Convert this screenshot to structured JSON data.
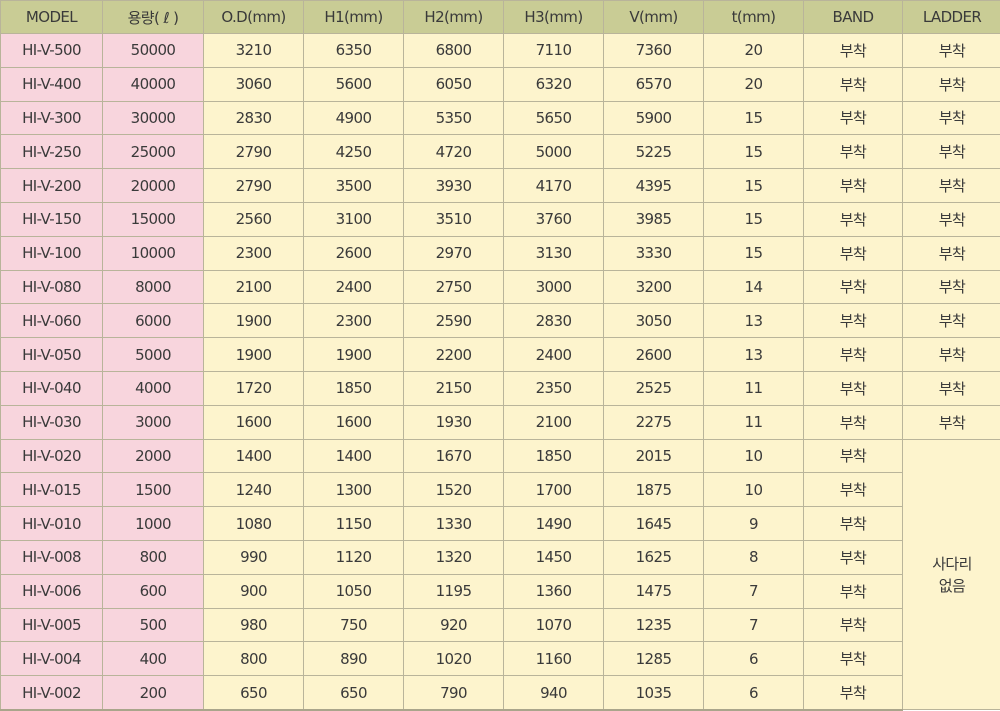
{
  "table": {
    "headers": [
      "MODEL",
      "용량( ℓ )",
      "O.D(mm)",
      "H1(mm)",
      "H2(mm)",
      "H3(mm)",
      "V(mm)",
      "t(mm)",
      "BAND",
      "LADDER"
    ],
    "rows": [
      {
        "model": "HI-V-500",
        "capacity": "50000",
        "od": "3210",
        "h1": "6350",
        "h2": "6800",
        "h3": "7110",
        "v": "7360",
        "t": "20",
        "band": "부착",
        "ladder": "부착"
      },
      {
        "model": "HI-V-400",
        "capacity": "40000",
        "od": "3060",
        "h1": "5600",
        "h2": "6050",
        "h3": "6320",
        "v": "6570",
        "t": "20",
        "band": "부착",
        "ladder": "부착"
      },
      {
        "model": "HI-V-300",
        "capacity": "30000",
        "od": "2830",
        "h1": "4900",
        "h2": "5350",
        "h3": "5650",
        "v": "5900",
        "t": "15",
        "band": "부착",
        "ladder": "부착"
      },
      {
        "model": "HI-V-250",
        "capacity": "25000",
        "od": "2790",
        "h1": "4250",
        "h2": "4720",
        "h3": "5000",
        "v": "5225",
        "t": "15",
        "band": "부착",
        "ladder": "부착"
      },
      {
        "model": "HI-V-200",
        "capacity": "20000",
        "od": "2790",
        "h1": "3500",
        "h2": "3930",
        "h3": "4170",
        "v": "4395",
        "t": "15",
        "band": "부착",
        "ladder": "부착"
      },
      {
        "model": "HI-V-150",
        "capacity": "15000",
        "od": "2560",
        "h1": "3100",
        "h2": "3510",
        "h3": "3760",
        "v": "3985",
        "t": "15",
        "band": "부착",
        "ladder": "부착"
      },
      {
        "model": "HI-V-100",
        "capacity": "10000",
        "od": "2300",
        "h1": "2600",
        "h2": "2970",
        "h3": "3130",
        "v": "3330",
        "t": "15",
        "band": "부착",
        "ladder": "부착"
      },
      {
        "model": "HI-V-080",
        "capacity": "8000",
        "od": "2100",
        "h1": "2400",
        "h2": "2750",
        "h3": "3000",
        "v": "3200",
        "t": "14",
        "band": "부착",
        "ladder": "부착"
      },
      {
        "model": "HI-V-060",
        "capacity": "6000",
        "od": "1900",
        "h1": "2300",
        "h2": "2590",
        "h3": "2830",
        "v": "3050",
        "t": "13",
        "band": "부착",
        "ladder": "부착"
      },
      {
        "model": "HI-V-050",
        "capacity": "5000",
        "od": "1900",
        "h1": "1900",
        "h2": "2200",
        "h3": "2400",
        "v": "2600",
        "t": "13",
        "band": "부착",
        "ladder": "부착"
      },
      {
        "model": "HI-V-040",
        "capacity": "4000",
        "od": "1720",
        "h1": "1850",
        "h2": "2150",
        "h3": "2350",
        "v": "2525",
        "t": "11",
        "band": "부착",
        "ladder": "부착"
      },
      {
        "model": "HI-V-030",
        "capacity": "3000",
        "od": "1600",
        "h1": "1600",
        "h2": "1930",
        "h3": "2100",
        "v": "2275",
        "t": "11",
        "band": "부착",
        "ladder": "부착"
      },
      {
        "model": "HI-V-020",
        "capacity": "2000",
        "od": "1400",
        "h1": "1400",
        "h2": "1670",
        "h3": "1850",
        "v": "2015",
        "t": "10",
        "band": "부착"
      },
      {
        "model": "HI-V-015",
        "capacity": "1500",
        "od": "1240",
        "h1": "1300",
        "h2": "1520",
        "h3": "1700",
        "v": "1875",
        "t": "10",
        "band": "부착"
      },
      {
        "model": "HI-V-010",
        "capacity": "1000",
        "od": "1080",
        "h1": "1150",
        "h2": "1330",
        "h3": "1490",
        "v": "1645",
        "t": "9",
        "band": "부착"
      },
      {
        "model": "HI-V-008",
        "capacity": "800",
        "od": "990",
        "h1": "1120",
        "h2": "1320",
        "h3": "1450",
        "v": "1625",
        "t": "8",
        "band": "부착"
      },
      {
        "model": "HI-V-006",
        "capacity": "600",
        "od": "900",
        "h1": "1050",
        "h2": "1195",
        "h3": "1360",
        "v": "1475",
        "t": "7",
        "band": "부착"
      },
      {
        "model": "HI-V-005",
        "capacity": "500",
        "od": "980",
        "h1": "750",
        "h2": "920",
        "h3": "1070",
        "v": "1235",
        "t": "7",
        "band": "부착"
      },
      {
        "model": "HI-V-004",
        "capacity": "400",
        "od": "800",
        "h1": "890",
        "h2": "1020",
        "h3": "1160",
        "v": "1285",
        "t": "6",
        "band": "부착"
      },
      {
        "model": "HI-V-002",
        "capacity": "200",
        "od": "650",
        "h1": "650",
        "h2": "790",
        "h3": "940",
        "v": "1035",
        "t": "6",
        "band": "부착"
      }
    ],
    "ladder_merged": {
      "line1": "사다리",
      "line2": "없음"
    }
  },
  "colors": {
    "header_bg": "#c9cc95",
    "model_col_bg": "#f8d5dd",
    "value_bg": "#fdf4cd",
    "border": "#b9b49a",
    "text": "#3a3a3a"
  }
}
